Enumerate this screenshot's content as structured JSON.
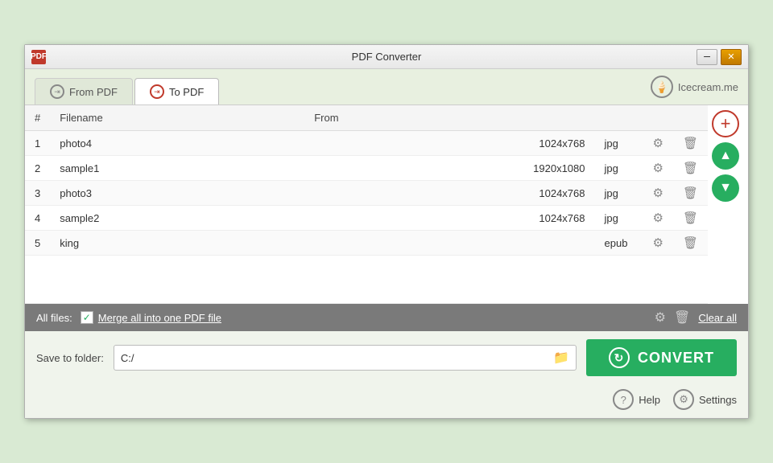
{
  "window": {
    "title": "PDF Converter",
    "icon_label": "PDF"
  },
  "tabs": {
    "from_pdf": "From PDF",
    "to_pdf": "To PDF",
    "active": "to_pdf"
  },
  "icecream": {
    "label": "Icecream.me"
  },
  "table": {
    "headers": {
      "num": "#",
      "filename": "Filename",
      "from": "From"
    },
    "rows": [
      {
        "num": 1,
        "name": "photo4",
        "dims": "1024x768",
        "format": "jpg"
      },
      {
        "num": 2,
        "name": "sample1",
        "dims": "1920x1080",
        "format": "jpg"
      },
      {
        "num": 3,
        "name": "photo3",
        "dims": "1024x768",
        "format": "jpg"
      },
      {
        "num": 4,
        "name": "sample2",
        "dims": "1024x768",
        "format": "jpg"
      },
      {
        "num": 5,
        "name": "king",
        "dims": "",
        "format": "epub"
      }
    ]
  },
  "bottom_bar": {
    "all_files_label": "All files:",
    "merge_label": "Merge all into one PDF file",
    "clear_label": "Clear all"
  },
  "save_row": {
    "label": "Save to folder:",
    "path": "C:/",
    "placeholder": "C:/"
  },
  "convert_button": "CONVERT",
  "footer": {
    "help": "Help",
    "settings": "Settings"
  }
}
